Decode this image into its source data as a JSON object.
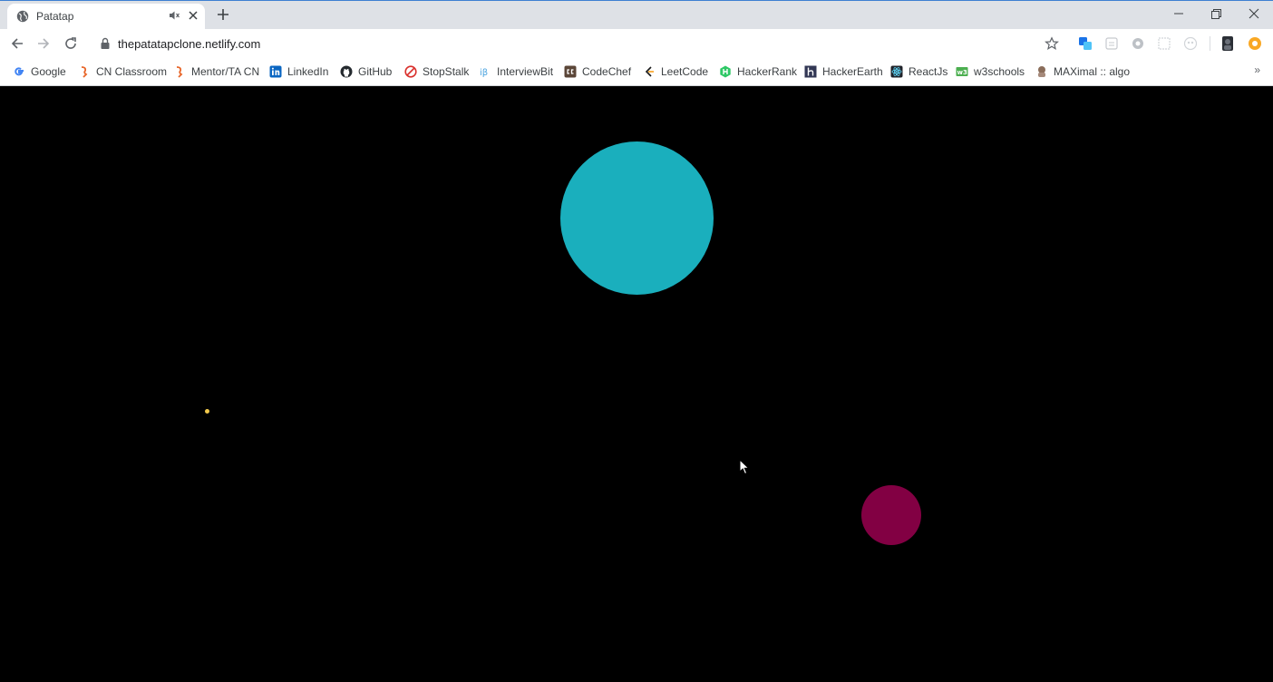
{
  "browser": {
    "tab": {
      "title": "Patatap"
    },
    "address_bar": {
      "url": "thepatatapclone.netlify.com"
    },
    "bookmarks": [
      {
        "label": "Google",
        "icon": "google-icon",
        "color": "#4285f4"
      },
      {
        "label": "CN Classroom",
        "icon": "coding-ninjas-icon",
        "color": "#e8662a"
      },
      {
        "label": "Mentor/TA CN",
        "icon": "coding-ninjas-icon",
        "color": "#e8662a"
      },
      {
        "label": "LinkedIn",
        "icon": "linkedin-icon",
        "color": "#0a66c2"
      },
      {
        "label": "GitHub",
        "icon": "github-icon",
        "color": "#24292e"
      },
      {
        "label": "StopStalk",
        "icon": "stopstalk-icon",
        "color": "#d9302c"
      },
      {
        "label": "InterviewBit",
        "icon": "interviewbit-icon",
        "color": "#4aa3df"
      },
      {
        "label": "CodeChef",
        "icon": "codechef-icon",
        "color": "#5b4638"
      },
      {
        "label": "LeetCode",
        "icon": "leetcode-icon",
        "color": "#f89f1b"
      },
      {
        "label": "HackerRank",
        "icon": "hackerrank-icon",
        "color": "#2ec866"
      },
      {
        "label": "HackerEarth",
        "icon": "hackerearth-icon",
        "color": "#323754"
      },
      {
        "label": "ReactJs",
        "icon": "react-icon",
        "color": "#20232a"
      },
      {
        "label": "w3schools",
        "icon": "w3schools-icon",
        "color": "#4caf50"
      },
      {
        "label": "MAXimal :: algo",
        "icon": "maximal-icon",
        "color": "#8a6d5a"
      }
    ],
    "overflow_label": "»"
  },
  "page": {
    "background": "#000000",
    "circles": [
      {
        "name": "large-teal-circle",
        "color": "#1aafbd"
      },
      {
        "name": "magenta-circle",
        "color": "#820043"
      },
      {
        "name": "small-yellow-dot",
        "color": "#f2c94c"
      }
    ]
  }
}
